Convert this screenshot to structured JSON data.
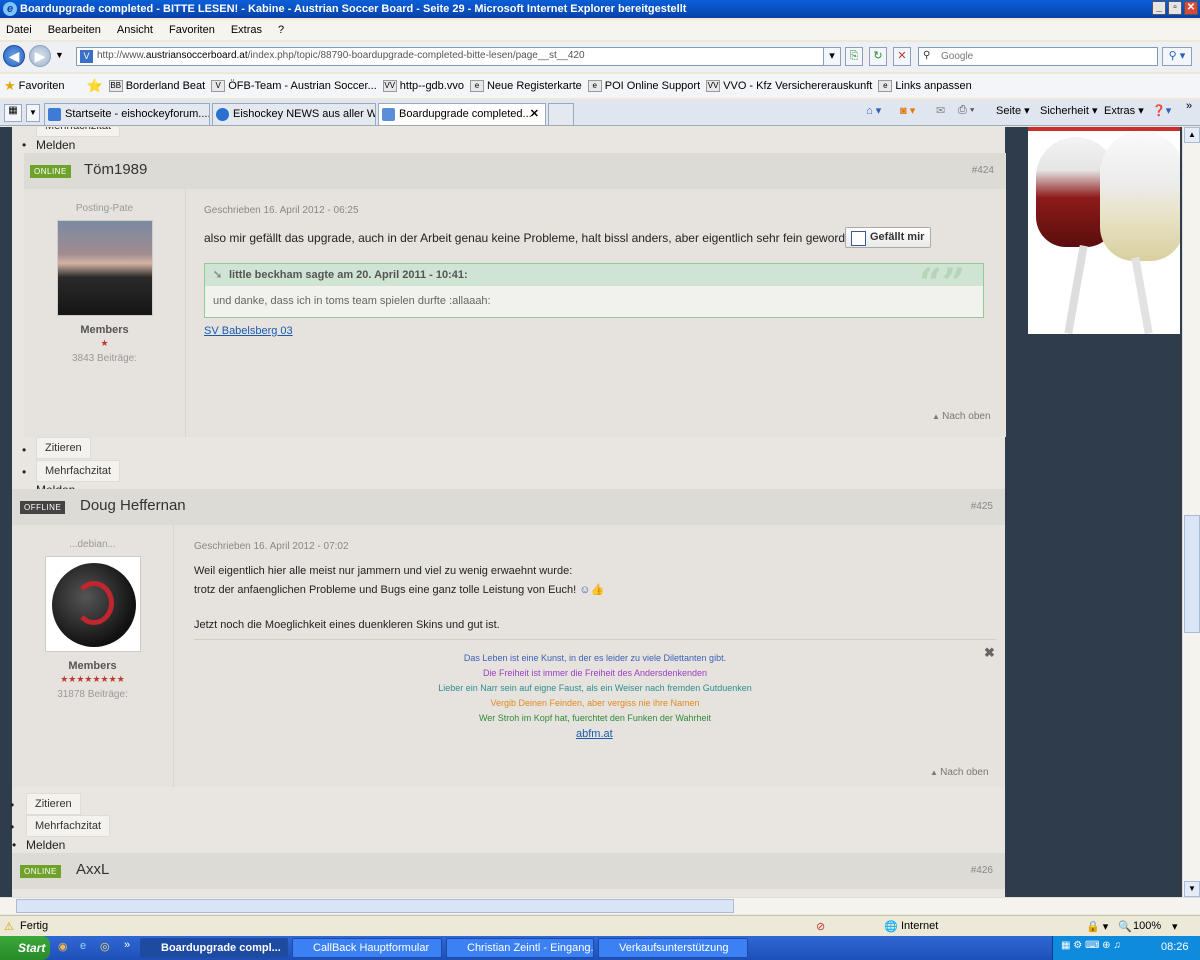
{
  "window": {
    "title": "Boardupgrade completed - BITTE LESEN! - Kabine - Austrian Soccer Board - Seite 29 - Microsoft Internet Explorer bereitgestellt",
    "buttons": [
      "_",
      "▫",
      "✕"
    ]
  },
  "menu": [
    "Datei",
    "Bearbeiten",
    "Ansicht",
    "Favoriten",
    "Extras",
    "?"
  ],
  "address": {
    "url_prefix": "http://www.",
    "url_domain": "austriansoccerboard.at",
    "url_rest": "/index.php/topic/88790-boardupgrade-completed-bitte-lesen/page__st__420",
    "search_placeholder": "Google"
  },
  "favorites": {
    "label": "Favoriten",
    "items": [
      {
        "icon": "BB",
        "label": "Borderland Beat"
      },
      {
        "icon": "V",
        "label": "ÖFB-Team - Austrian Soccer..."
      },
      {
        "icon": "VV",
        "label": "http--gdb.vvo"
      },
      {
        "icon": "e",
        "label": "Neue Registerkarte"
      },
      {
        "icon": "e",
        "label": "POI Online Support"
      },
      {
        "icon": "VV",
        "label": "VVO - Kfz Versichererauskunft"
      },
      {
        "icon": "e",
        "label": "Links anpassen"
      }
    ]
  },
  "tabs": [
    {
      "label": "Startseite - eishockeyforum...."
    },
    {
      "label": "Eishockey NEWS aus aller W..."
    },
    {
      "label": "Boardupgrade completed..."
    }
  ],
  "toolbar": {
    "seite": "Seite ▾",
    "sicherheit": "Sicherheit ▾",
    "extras": "Extras ▾"
  },
  "top": {
    "melden": "Melden",
    "mehrfach": "Mehrfachzitat"
  },
  "post424": {
    "status": "ONLINE",
    "name": "Töm1989",
    "number": "#424",
    "rank": "Posting-Pate",
    "group": "Members",
    "stars": "★",
    "posts": "3843 Beiträge:",
    "date": "Geschrieben 16. April 2012 - 06:25",
    "text": "also mir gefällt das upgrade, auch in der Arbeit genau keine Probleme, halt bissl anders, aber eigentlich sehr fein geworden.",
    "like": "Gefällt mir",
    "quote_head": "little beckham sagte am 20. April 2011 - 10:41:",
    "quote_body": "und danke, dass ich in toms team spielen durfte :allaaah:",
    "sig_link": "SV Babelsberg 03",
    "back_top": "Nach oben",
    "actions": [
      "Zitieren",
      "Mehrfachzitat",
      "Melden"
    ]
  },
  "post425": {
    "status": "OFFLINE",
    "name": "Doug Heffernan",
    "number": "#425",
    "rank": "...debian...",
    "group": "Members",
    "stars": "★★★★★★★★",
    "posts": "31878 Beiträge:",
    "date": "Geschrieben 16. April 2012 - 07:02",
    "line1": "Weil eigentlich hier alle meist nur jammern und viel zu wenig erwaehnt wurde:",
    "line2": "trotz der anfaenglichen Probleme und Bugs eine ganz tolle Leistung von Euch!",
    "line3": "Jetzt noch die Moeglichkeit eines duenkleren Skins und gut ist.",
    "sig": [
      {
        "text": "Das Leben ist eine Kunst, in der es leider zu viele Dilettanten gibt.",
        "color": "#3d5fb8"
      },
      {
        "text": "Die Freiheit ist immer die Freiheit des Andersdenkenden",
        "color": "#9a3fc2"
      },
      {
        "text": "Lieber ein Narr sein auf eigne Faust, als ein Weiser nach fremden Gutduenken",
        "color": "#2d8f8f"
      },
      {
        "text": "Vergib Deinen Feinden, aber vergiss nie ihre Namen",
        "color": "#e08a1e"
      },
      {
        "text": "Wer Stroh im Kopf hat, fuerchtet den Funken der Wahrheit",
        "color": "#2f8a3a"
      }
    ],
    "sig_link": "abfm.at",
    "back_top": "Nach oben",
    "actions": [
      "Zitieren",
      "Mehrfachzitat",
      "Melden"
    ]
  },
  "post426": {
    "status": "ONLINE",
    "name": "AxxL",
    "number": "#426"
  },
  "statusbar": {
    "left": "Fertig",
    "zone": "Internet",
    "zoom": "100%"
  },
  "taskbar": {
    "start": "Start",
    "items": [
      {
        "label": "Boardupgrade compl..."
      },
      {
        "label": "CallBack Hauptformular"
      },
      {
        "label": "Christian Zeintl - Eingang..."
      },
      {
        "label": "Verkaufsunterstützung"
      }
    ],
    "clock": "08:26"
  }
}
